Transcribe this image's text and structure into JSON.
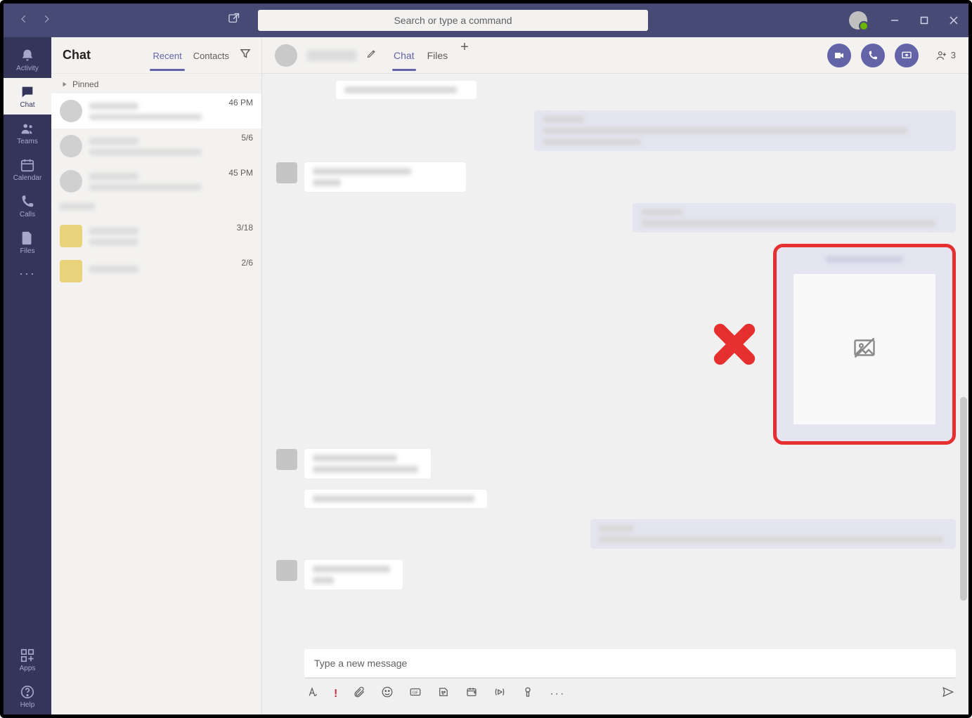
{
  "titlebar": {
    "search_placeholder": "Search or type a command"
  },
  "rail": {
    "activity": "Activity",
    "chat": "Chat",
    "teams": "Teams",
    "calendar": "Calendar",
    "calls": "Calls",
    "files": "Files",
    "more": "···",
    "apps": "Apps",
    "help": "Help"
  },
  "list": {
    "title": "Chat",
    "tab_recent": "Recent",
    "tab_contacts": "Contacts",
    "section_pinned": "Pinned",
    "items": [
      {
        "time": "46 PM"
      },
      {
        "time": "5/6"
      },
      {
        "time": "45 PM"
      },
      {
        "time": ""
      },
      {
        "time": "3/18"
      },
      {
        "time": "2/6"
      }
    ]
  },
  "conv": {
    "tab_chat": "Chat",
    "tab_files": "Files",
    "participants_count": "3"
  },
  "compose": {
    "placeholder": "Type a new message",
    "exclaim": "!",
    "more": "···"
  }
}
